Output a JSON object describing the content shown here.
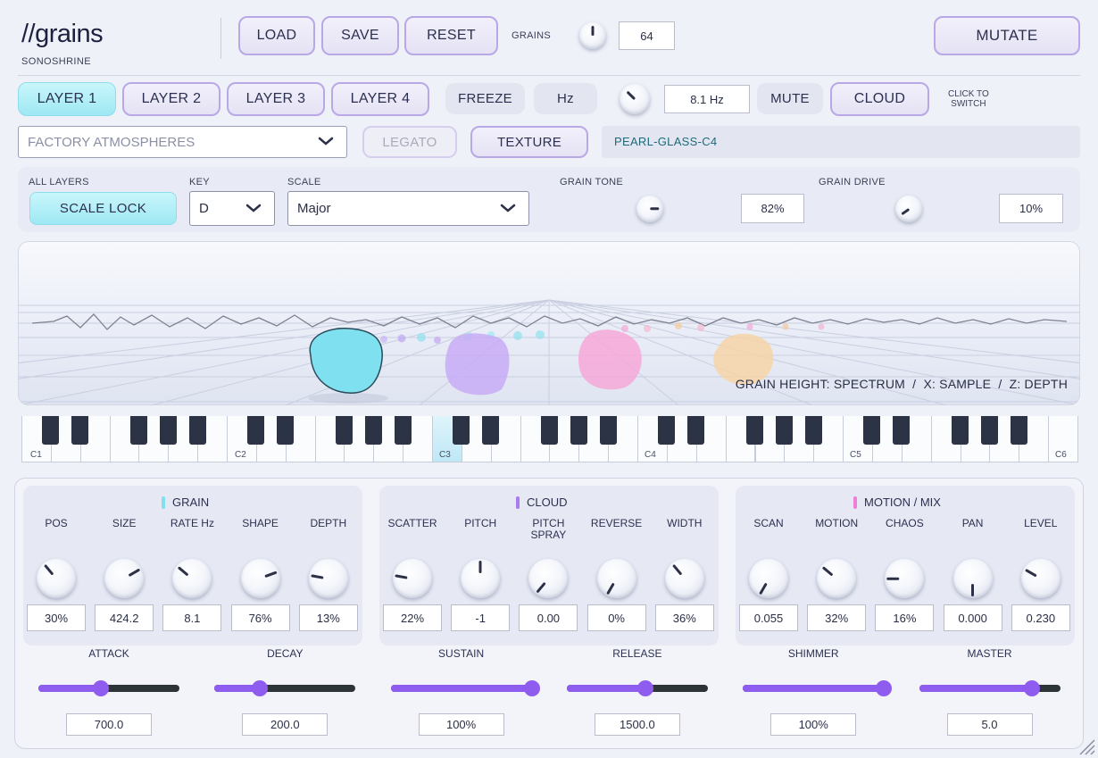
{
  "brand": {
    "logo": "//grains",
    "sub": "SONOSHRINE"
  },
  "top": {
    "load": "LOAD",
    "save": "SAVE",
    "reset": "RESET",
    "grains_label": "GRAINS",
    "grains_value": "64",
    "mutate": "MUTATE"
  },
  "layers": {
    "l1": "LAYER 1",
    "l2": "LAYER 2",
    "l3": "LAYER 3",
    "l4": "LAYER 4",
    "freeze": "FREEZE",
    "hz": "Hz",
    "rate_value": "8.1 Hz",
    "mute": "MUTE",
    "cloud": "CLOUD",
    "hint_line1": "CLICK TO",
    "hint_line2": "SWITCH"
  },
  "preset": {
    "bank": "FACTORY ATMOSPHERES",
    "legato": "LEGATO",
    "texture": "TEXTURE",
    "name": "PEARL-GLASS-C4"
  },
  "scale": {
    "all_layers": "ALL LAYERS",
    "scale_lock": "SCALE LOCK",
    "key_label": "KEY",
    "key_value": "D",
    "scale_label": "SCALE",
    "scale_value": "Major",
    "tone_label": "GRAIN TONE",
    "tone_value": "82%",
    "drive_label": "GRAIN DRIVE",
    "drive_value": "10%"
  },
  "viz": {
    "caption": "GRAIN HEIGHT: SPECTRUM  /  X: SAMPLE  /  Z: DEPTH"
  },
  "keyboard": {
    "c1": "C1",
    "c2": "C2",
    "c3": "C3",
    "c4": "C4",
    "c5": "C5",
    "c6": "C6"
  },
  "grain": {
    "title": "GRAIN",
    "params": [
      {
        "label": "POS",
        "value": "30%"
      },
      {
        "label": "SIZE",
        "value": "424.2"
      },
      {
        "label": "RATE Hz",
        "value": "8.1"
      },
      {
        "label": "SHAPE",
        "value": "76%"
      },
      {
        "label": "DEPTH",
        "value": "13%"
      }
    ]
  },
  "cloud": {
    "title": "CLOUD",
    "params": [
      {
        "label": "SCATTER",
        "value": "22%"
      },
      {
        "label": "PITCH",
        "value": "-1"
      },
      {
        "label": "PITCH SPRAY",
        "value": "0.00"
      },
      {
        "label": "REVERSE",
        "value": "0%"
      },
      {
        "label": "WIDTH",
        "value": "36%"
      }
    ]
  },
  "motion": {
    "title": "MOTION / MIX",
    "params": [
      {
        "label": "SCAN",
        "value": "0.055"
      },
      {
        "label": "MOTION",
        "value": "32%"
      },
      {
        "label": "CHAOS",
        "value": "16%"
      },
      {
        "label": "PAN",
        "value": "0.000"
      },
      {
        "label": "LEVEL",
        "value": "0.230"
      }
    ]
  },
  "sliders": [
    {
      "label": "ATTACK",
      "value": "700.0",
      "level": 0.44
    },
    {
      "label": "DECAY",
      "value": "200.0",
      "level": 0.32
    },
    {
      "label": "SUSTAIN",
      "value": "100%",
      "level": 1.0
    },
    {
      "label": "RELEASE",
      "value": "1500.0",
      "level": 0.56
    },
    {
      "label": "SHIMMER",
      "value": "100%",
      "level": 1.0
    },
    {
      "label": "MASTER",
      "value": "5.0",
      "level": 0.8
    }
  ],
  "colors": {
    "accent": "#8f5cf0",
    "grain_mark": "#7fe0ee",
    "cloud_mark": "#a77cf0",
    "motion_mark": "#ef7fd6"
  }
}
